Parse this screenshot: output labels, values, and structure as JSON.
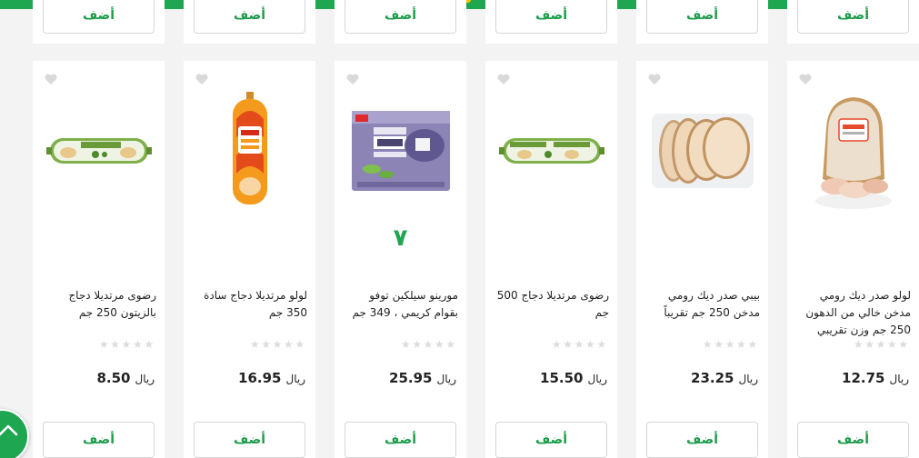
{
  "colors": {
    "brand_green": "#1ea650",
    "accent_yellow": "#f2c300"
  },
  "add_label": "أضف",
  "currency": "ريال",
  "top_row": [
    {},
    {},
    {},
    {},
    {},
    {}
  ],
  "products": [
    {
      "name": "لولو صدر ديك رومي مدخن خالي من الدهون 250 جم وزن تقريبي",
      "price": "12.75",
      "rating": 0,
      "image": "turkey-breast-roll"
    },
    {
      "name": "بيبي صدر ديك رومي مدخن 250 جم تقريباً",
      "price": "23.25",
      "rating": 0,
      "image": "smoked-turkey-slices"
    },
    {
      "name": "رضوى مرتديلا دجاج 500 جم",
      "price": "15.50",
      "rating": 0,
      "image": "chicken-mortadella-roll"
    },
    {
      "name": "مورينو سيلكين توفو بقوام كريمي ، 349 جم",
      "price": "25.95",
      "rating": 0,
      "image": "tofu-box",
      "badge": "٧"
    },
    {
      "name": "لولو مرتديلا دجاج سادة 350 جم",
      "price": "16.95",
      "rating": 0,
      "image": "mortadella-chub"
    },
    {
      "name": "رضوى مرتديلا دجاج بالزيتون 250 جم",
      "price": "8.50",
      "rating": 0,
      "image": "chicken-mortadella-roll"
    }
  ]
}
